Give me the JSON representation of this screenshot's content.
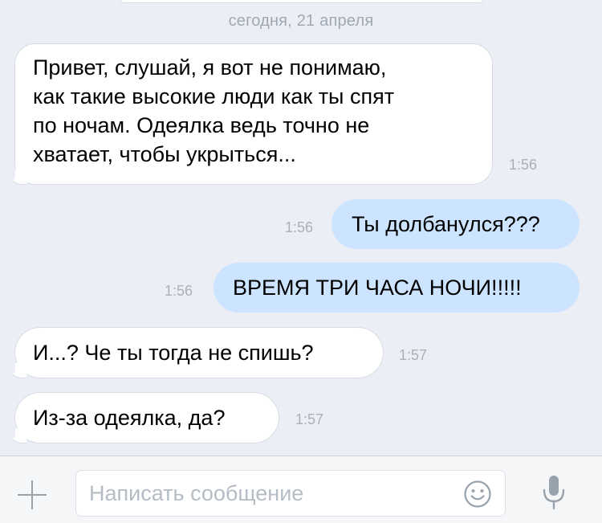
{
  "chat": {
    "date_separator": "сегодня, 21 апреля",
    "messages": [
      {
        "direction": "incoming",
        "lines": [
          "Привет, слушай, я вот не понимаю,",
          "как такие высокие люди как ты спят",
          "по ночам. Одеялка ведь точно не",
          "хватает, чтобы укрыться..."
        ],
        "time": "1:56"
      },
      {
        "direction": "outgoing",
        "text": "Ты долбанулся???",
        "time": "1:56"
      },
      {
        "direction": "outgoing",
        "text": "ВРЕМЯ ТРИ ЧАСА НОЧИ!!!!!",
        "time": "1:56"
      },
      {
        "direction": "incoming",
        "text": "И...? Че ты тогда не спишь?",
        "time": "1:57"
      },
      {
        "direction": "incoming",
        "text": "Из-за одеялка, да?",
        "time": "1:57"
      }
    ]
  },
  "composer": {
    "placeholder": "Написать сообщение",
    "value": "",
    "attach_icon": "plus-icon",
    "emoji_icon": "smile-icon",
    "voice_icon": "microphone-icon"
  },
  "colors": {
    "background": "#ebeff5",
    "incoming_bubble": "#ffffff",
    "outgoing_bubble": "#cce4ff",
    "timestamp": "#a9b0ba",
    "icon": "#98a2ad"
  }
}
